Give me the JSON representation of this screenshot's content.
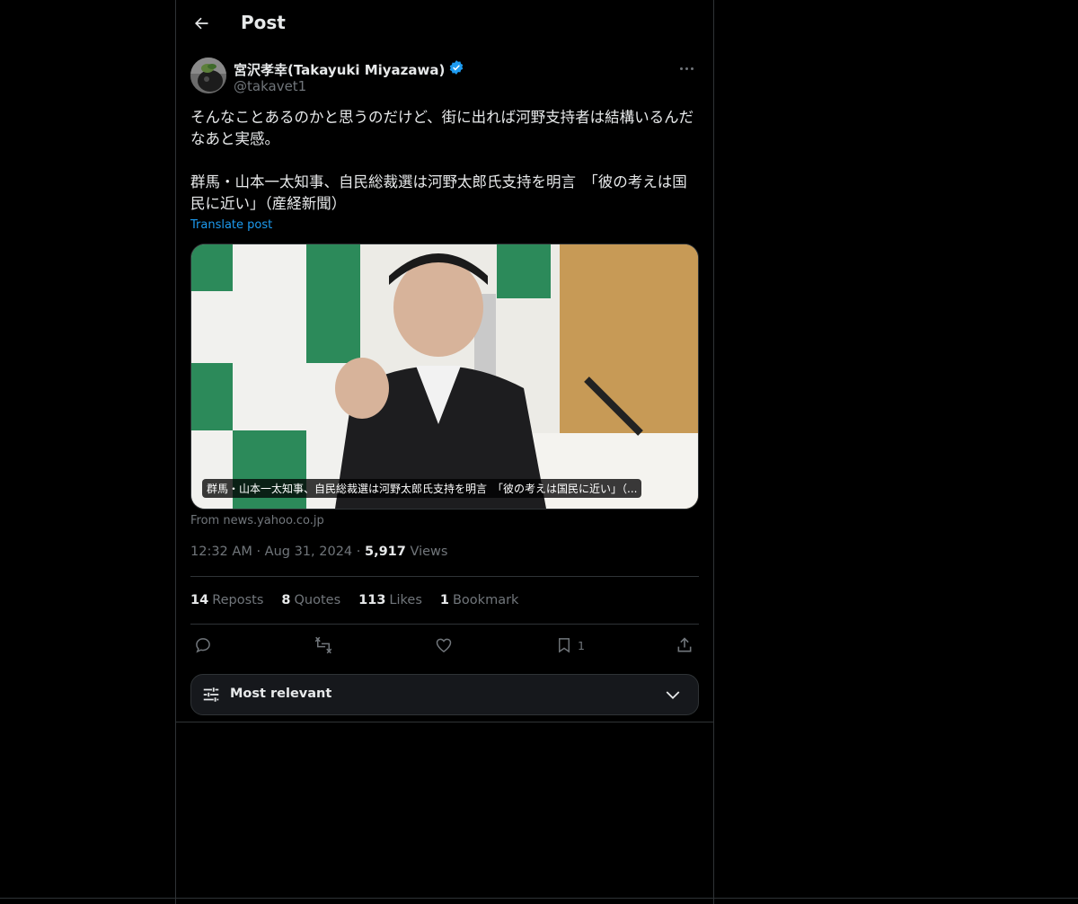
{
  "header": {
    "title": "Post"
  },
  "author": {
    "display_name": "宮沢孝幸(Takayuki Miyazawa)",
    "handle": "@takavet1",
    "verified": true
  },
  "post": {
    "text": "そんなことあるのかと思うのだけど、街に出れば河野支持者は結構いるんだなあと実感。\n\n群馬・山本一太知事、自民総裁選は河野太郎氏支持を明言　「彼の考えは国民に近い」（産経新聞）",
    "translate_label": "Translate post"
  },
  "link_card": {
    "caption": "群馬・山本一太知事、自民総裁選は河野太郎氏支持を明言　「彼の考えは国民に近い」（...",
    "from_label": "From news.yahoo.co.jp"
  },
  "meta": {
    "time": "12:32 AM",
    "date": "Aug 31, 2024",
    "views_count": "5,917",
    "views_label": "Views"
  },
  "stats": {
    "reposts_count": "14",
    "reposts_label": "Reposts",
    "quotes_count": "8",
    "quotes_label": "Quotes",
    "likes_count": "113",
    "likes_label": "Likes",
    "bookmarks_count": "1",
    "bookmarks_label": "Bookmark"
  },
  "actions": {
    "bookmark_count": "1"
  },
  "sort": {
    "label": "Most relevant"
  },
  "icons": {
    "back": "arrow-left-icon",
    "verified": "verified-badge-icon",
    "more": "more-icon",
    "reply": "reply-icon",
    "repost": "repost-icon",
    "like": "heart-icon",
    "bookmark": "bookmark-icon",
    "share": "share-icon",
    "filter": "sliders-icon",
    "chevron": "chevron-down-icon"
  },
  "colors": {
    "background": "#000000",
    "text": "#e7e9ea",
    "muted": "#71767b",
    "accent": "#1d9bf0",
    "border": "#2f3336"
  }
}
